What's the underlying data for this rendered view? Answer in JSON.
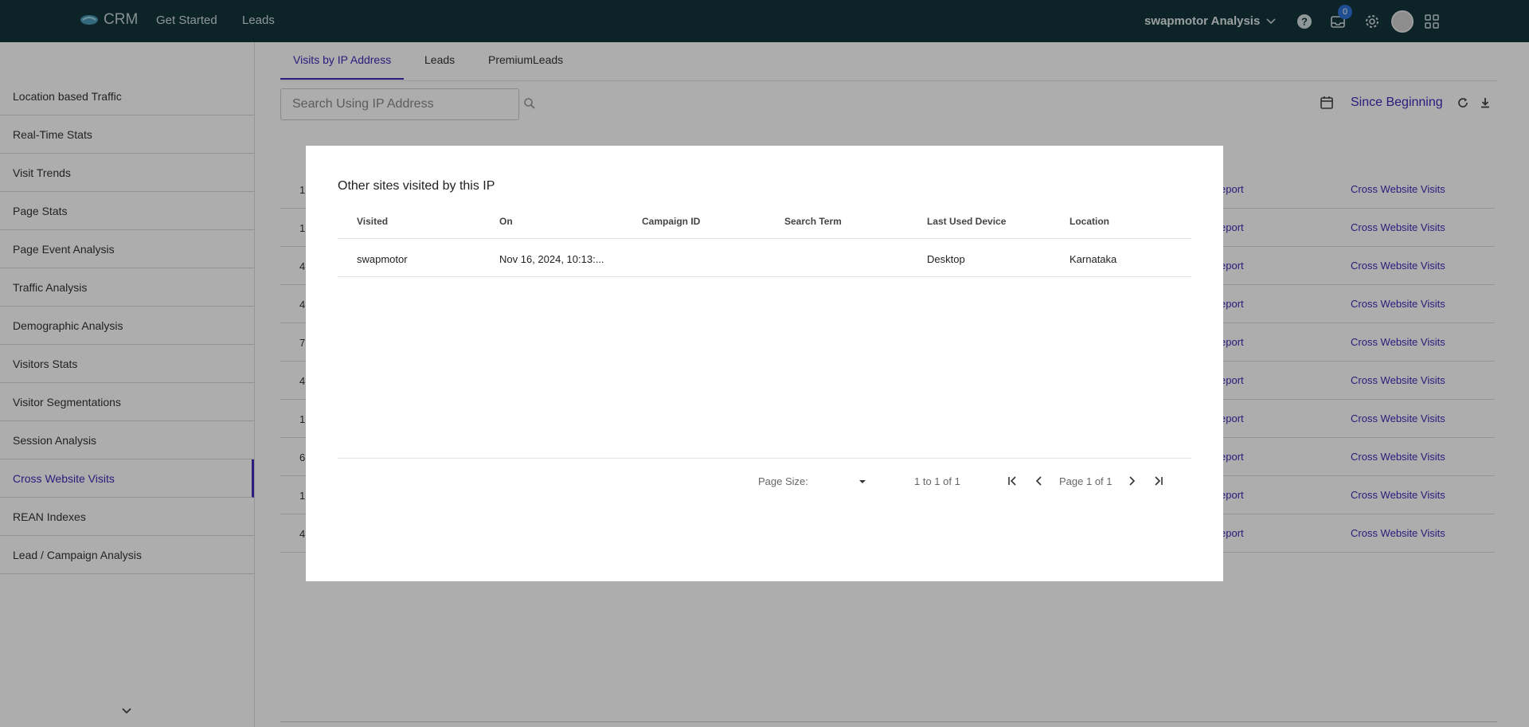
{
  "topbar": {
    "brand": "CRM",
    "nav": [
      "Get Started",
      "Leads"
    ],
    "org": "swapmotor Analysis",
    "notification_count": "0",
    "icons": [
      "help-icon",
      "inbox-icon",
      "gear-icon",
      "avatar",
      "apps-grid-icon"
    ]
  },
  "sidebar": {
    "items": [
      "Location based Traffic",
      "Real-Time Stats",
      "Visit Trends",
      "Page Stats",
      "Page Event Analysis",
      "Traffic Analysis",
      "Demographic Analysis",
      "Visitors Stats",
      "Visitor Segmentations",
      "Session Analysis",
      "Cross Website Visits",
      "REAN Indexes",
      "Lead / Campaign Analysis"
    ],
    "active_index": 10
  },
  "main": {
    "tabs": [
      "Visits by IP Address",
      "Leads",
      "PremiumLeads"
    ],
    "search_placeholder": "Search Using IP Address",
    "date_range": "Since Beginning",
    "rows": [
      {
        "first": "1",
        "report": "eport",
        "cross": "Cross Website Visits"
      },
      {
        "first": "1",
        "report": "eport",
        "cross": "Cross Website Visits"
      },
      {
        "first": "4",
        "report": "eport",
        "cross": "Cross Website Visits"
      },
      {
        "first": "4",
        "report": "eport",
        "cross": "Cross Website Visits"
      },
      {
        "first": "7",
        "report": "eport",
        "cross": "Cross Website Visits"
      },
      {
        "first": "4",
        "report": "eport",
        "cross": "Cross Website Visits"
      },
      {
        "first": "1",
        "report": "eport",
        "cross": "Cross Website Visits"
      },
      {
        "first": "6",
        "report": "eport",
        "cross": "Cross Website Visits"
      },
      {
        "first": "1",
        "report": "eport",
        "cross": "Cross Website Visits"
      },
      {
        "first": "4",
        "report": "eport",
        "cross": "Cross Website Visits"
      }
    ]
  },
  "modal": {
    "title": "Other sites visited by this IP",
    "columns": [
      "Visited",
      "On",
      "Campaign ID",
      "Search Term",
      "Last Used Device",
      "Location"
    ],
    "rows": [
      [
        "swapmotor",
        "Nov 16, 2024, 10:13:...",
        "",
        "",
        "Desktop",
        "Karnataka"
      ]
    ],
    "pager": {
      "page_size_label": "Page Size:",
      "range": "1 to 1 of 1",
      "page_text": "Page 1 of 1"
    }
  },
  "colors": {
    "topbar": "#12343b",
    "accent": "#3d2bb8",
    "badge": "#2f73d8"
  }
}
